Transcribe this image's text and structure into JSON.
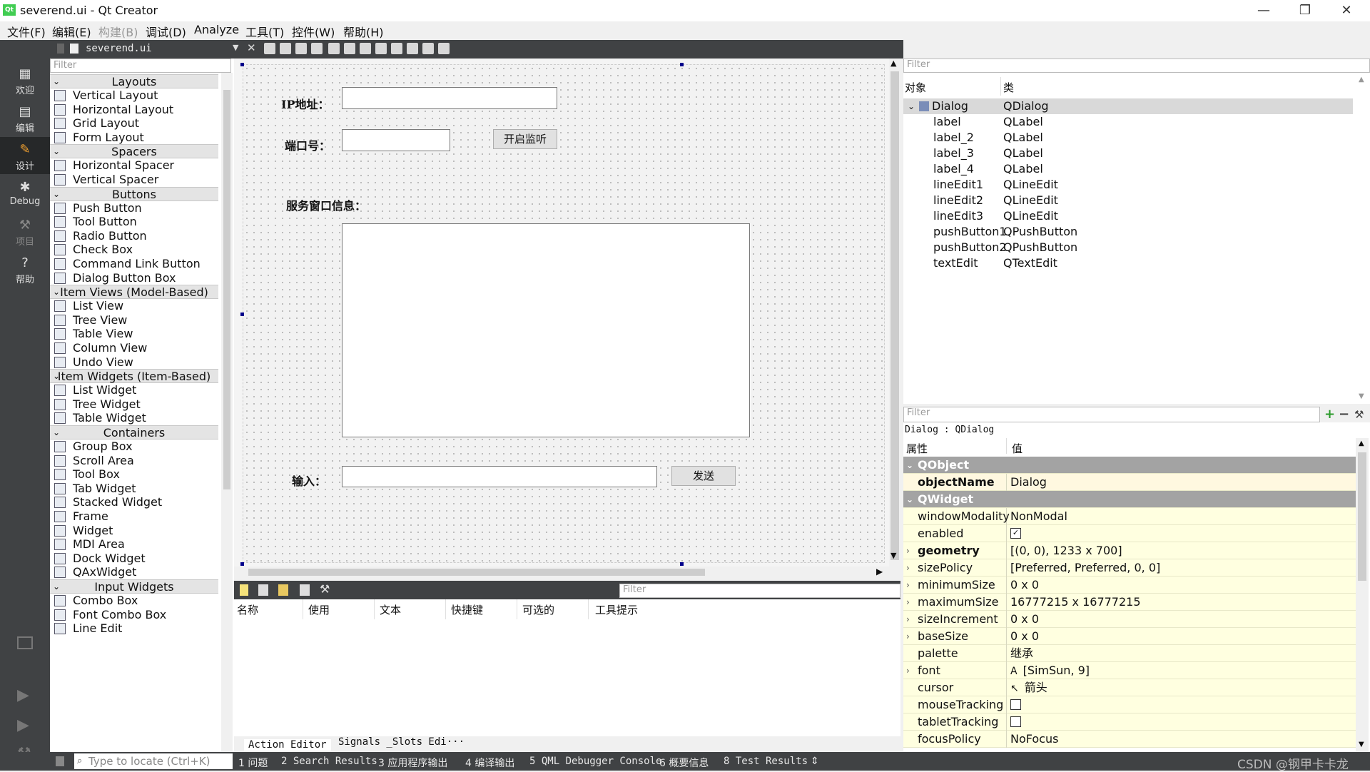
{
  "window": {
    "app_icon": "qt-creator-icon",
    "title": "severend.ui - Qt Creator",
    "controls": [
      "minimize-icon",
      "restore-icon",
      "close-icon"
    ]
  },
  "menubar": {
    "items": [
      "文件(F)",
      "编辑(E)",
      "构建(B)",
      "调试(D)",
      "Analyze",
      "工具(T)",
      "控件(W)",
      "帮助(H)"
    ]
  },
  "modes": [
    {
      "label": "欢迎",
      "icon": "grid-icon"
    },
    {
      "label": "编辑",
      "icon": "edit-doc-icon"
    },
    {
      "label": "设计",
      "icon": "pencil-icon",
      "active": true
    },
    {
      "label": "Debug",
      "icon": "bug-icon"
    },
    {
      "label": "项目",
      "icon": "wrench-icon",
      "disabled": true
    },
    {
      "label": "帮助",
      "icon": "help-icon"
    }
  ],
  "editor_tab": {
    "file": "severend.ui"
  },
  "widgetbox": {
    "filter_placeholder": "Filter",
    "categories": [
      {
        "name": "Layouts",
        "items": [
          "Vertical Layout",
          "Horizontal Layout",
          "Grid Layout",
          "Form Layout"
        ]
      },
      {
        "name": "Spacers",
        "items": [
          "Horizontal Spacer",
          "Vertical Spacer"
        ]
      },
      {
        "name": "Buttons",
        "items": [
          "Push Button",
          "Tool Button",
          "Radio Button",
          "Check Box",
          "Command Link Button",
          "Dialog Button Box"
        ]
      },
      {
        "name": "Item Views (Model-Based)",
        "items": [
          "List View",
          "Tree View",
          "Table View",
          "Column View",
          "Undo View"
        ]
      },
      {
        "name": "Item Widgets (Item-Based)",
        "items": [
          "List Widget",
          "Tree Widget",
          "Table Widget"
        ]
      },
      {
        "name": "Containers",
        "items": [
          "Group Box",
          "Scroll Area",
          "Tool Box",
          "Tab Widget",
          "Stacked Widget",
          "Frame",
          "Widget",
          "MDI Area",
          "Dock Widget",
          "QAxWidget"
        ]
      },
      {
        "name": "Input Widgets",
        "items": [
          "Combo Box",
          "Font Combo Box",
          "Line Edit"
        ]
      }
    ]
  },
  "form": {
    "ip_label": "IP地址：",
    "port_label": "端口号：",
    "listen_button": "开启监听",
    "info_label": "服务窗口信息：",
    "input_label": "输入：",
    "send_button": "发送"
  },
  "action_editor": {
    "filter_placeholder": "Filter",
    "columns": [
      "名称",
      "使用",
      "文本",
      "快捷键",
      "可选的",
      "工具提示"
    ],
    "tabs": [
      "Action Editor",
      "Signals _Slots Edi···"
    ]
  },
  "object_inspector": {
    "filter_placeholder": "Filter",
    "headers": [
      "对象",
      "类"
    ],
    "root": {
      "name": "Dialog",
      "class": "QDialog"
    },
    "children": [
      {
        "name": "label",
        "class": "QLabel"
      },
      {
        "name": "label_2",
        "class": "QLabel"
      },
      {
        "name": "label_3",
        "class": "QLabel"
      },
      {
        "name": "label_4",
        "class": "QLabel"
      },
      {
        "name": "lineEdit1",
        "class": "QLineEdit"
      },
      {
        "name": "lineEdit2",
        "class": "QLineEdit"
      },
      {
        "name": "lineEdit3",
        "class": "QLineEdit"
      },
      {
        "name": "pushButton1",
        "class": "QPushButton"
      },
      {
        "name": "pushButton2",
        "class": "QPushButton"
      },
      {
        "name": "textEdit",
        "class": "QTextEdit"
      }
    ]
  },
  "property_editor": {
    "filter_placeholder": "Filter",
    "context": "Dialog : QDialog",
    "headers": [
      "属性",
      "值"
    ],
    "rows": [
      {
        "name": "QObject",
        "group": true
      },
      {
        "name": "objectName",
        "value": "Dialog",
        "bold": true
      },
      {
        "name": "QWidget",
        "group": true
      },
      {
        "name": "windowModality",
        "value": "NonModal"
      },
      {
        "name": "enabled",
        "checkbox": true,
        "checked": true
      },
      {
        "name": "geometry",
        "value": "[(0, 0), 1233 x 700]",
        "bold": true,
        "expand": true
      },
      {
        "name": "sizePolicy",
        "value": "[Preferred, Preferred, 0, 0]",
        "expand": true
      },
      {
        "name": "minimumSize",
        "value": "0 x 0",
        "expand": true
      },
      {
        "name": "maximumSize",
        "value": "16777215 x 16777215",
        "expand": true
      },
      {
        "name": "sizeIncrement",
        "value": "0 x 0",
        "expand": true
      },
      {
        "name": "baseSize",
        "value": "0 x 0",
        "expand": true
      },
      {
        "name": "palette",
        "value": "继承"
      },
      {
        "name": "font",
        "value": "[SimSun, 9]",
        "expand": true,
        "prefix": "A"
      },
      {
        "name": "cursor",
        "value": "箭头",
        "prefix": "↖"
      },
      {
        "name": "mouseTracking",
        "checkbox": true,
        "checked": false
      },
      {
        "name": "tabletTracking",
        "checkbox": true,
        "checked": false
      },
      {
        "name": "focusPolicy",
        "value": "NoFocus"
      }
    ]
  },
  "statusbar": {
    "locator_placeholder": "Type to locate (Ctrl+K)",
    "panes": [
      "1 问题",
      "2 Search Results",
      "3 应用程序输出",
      "4 编译输出",
      "5 QML Debugger Console",
      "6 概要信息",
      "8 Test Results"
    ],
    "watermark": "CSDN @钢甲卡卡龙"
  }
}
